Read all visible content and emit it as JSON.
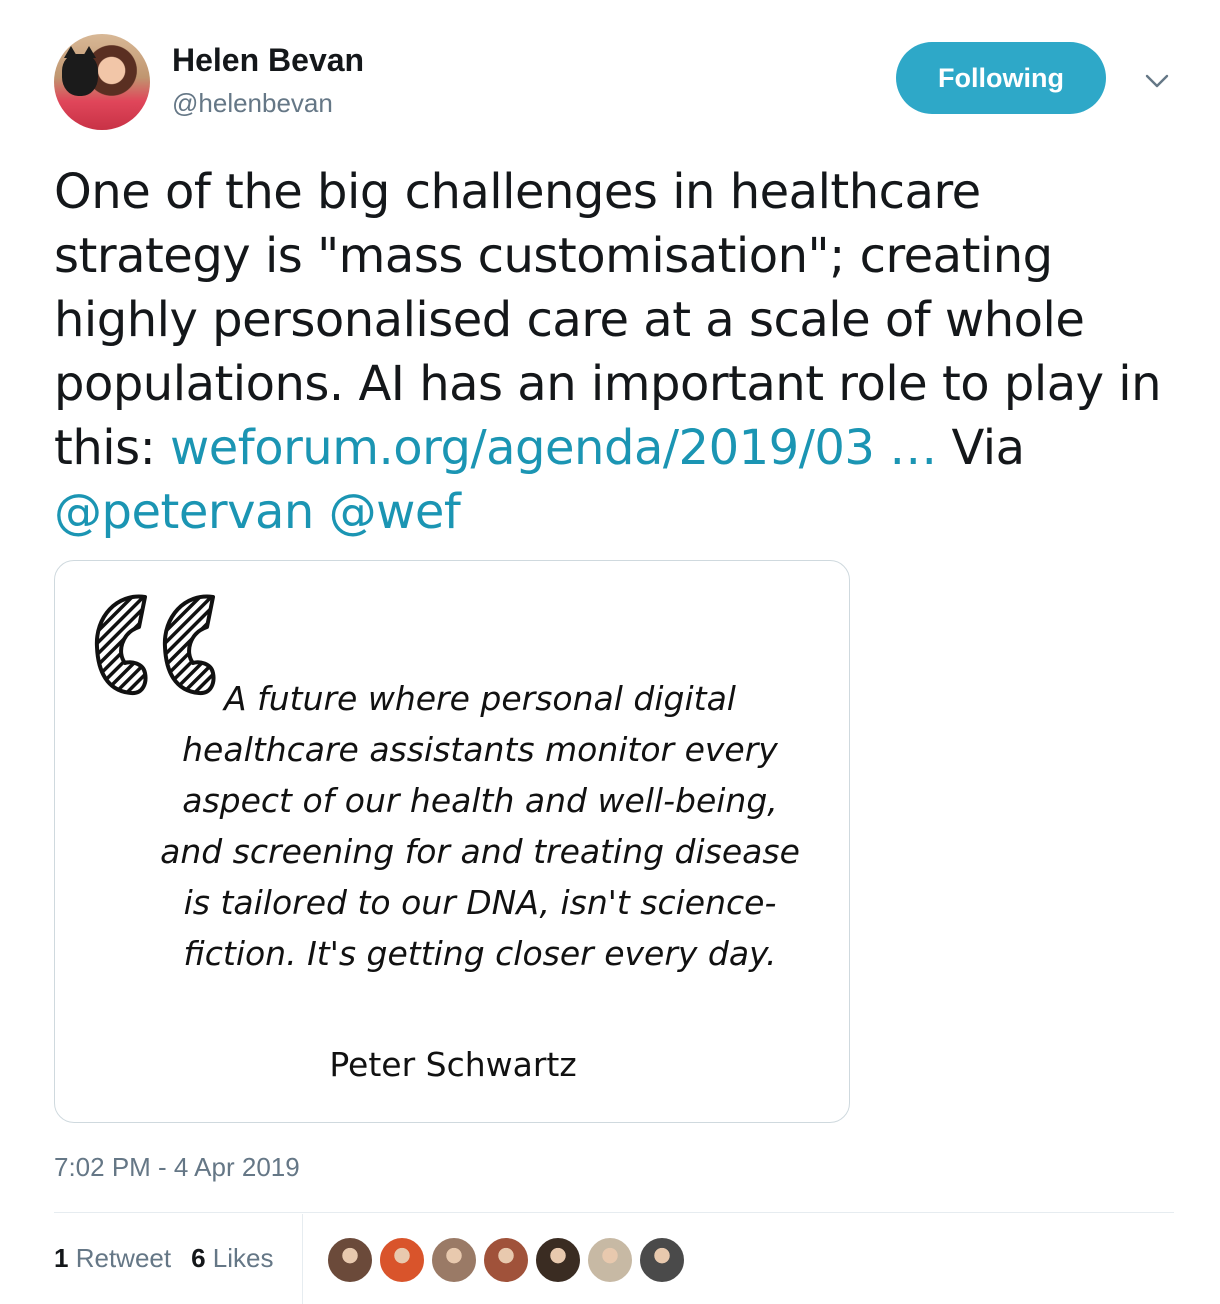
{
  "author": {
    "name": "Helen Bevan",
    "handle": "@helenbevan"
  },
  "follow_button": {
    "label": "Following",
    "color": "#2ea8c8"
  },
  "tweet": {
    "text_before_link": "One of the big challenges in healthcare strategy is \"mass customisation\"; creating highly personalised care at a scale of whole populations. AI has an important role to play in this: ",
    "link": "weforum.org/agenda/2019/03 …",
    "via": " Via ",
    "mention_1": "@petervan",
    "mention_2": "@wef"
  },
  "quote_card": {
    "quote": "A future where personal digital healthcare assistants monitor every aspect of our health and well-being, and screening for and treating disease is tailored to our DNA, isn't science-fiction. It's getting closer every day.",
    "author": "Peter Schwartz"
  },
  "timestamp": "7:02 PM - 4 Apr 2019",
  "stats": {
    "retweet_count": "1",
    "retweet_label": "Retweet",
    "like_count": "6",
    "like_label": "Likes"
  },
  "likers": [
    {
      "icon": "liker-avatar-1",
      "color": "#6b4a3a"
    },
    {
      "icon": "liker-avatar-2",
      "color": "#d9542b"
    },
    {
      "icon": "liker-avatar-3",
      "color": "#9a7a66"
    },
    {
      "icon": "liker-avatar-4",
      "color": "#a0523a"
    },
    {
      "icon": "liker-avatar-5",
      "color": "#3a2c22"
    },
    {
      "icon": "liker-avatar-6",
      "color": "#c7b9a4"
    },
    {
      "icon": "liker-avatar-7",
      "color": "#4a4a4a"
    }
  ],
  "colors": {
    "link": "#1b95b3",
    "secondary_text": "#657786"
  }
}
